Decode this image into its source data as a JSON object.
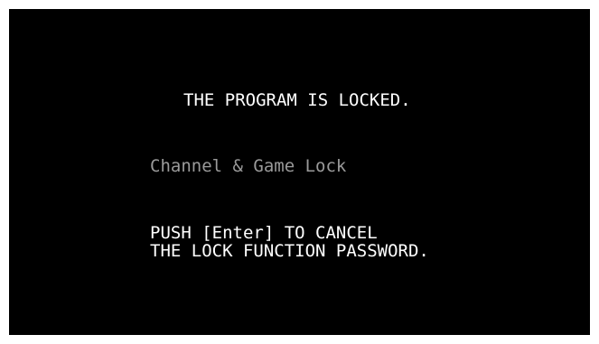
{
  "screen": {
    "title": "THE PROGRAM IS LOCKED.",
    "subtitle": "Channel & Game Lock",
    "instruction_line1": "PUSH [Enter] TO CANCEL",
    "instruction_line2": "THE LOCK FUNCTION PASSWORD."
  },
  "colors": {
    "background": "#000000",
    "text": "#ffffff",
    "subtitle_text": "#9a9a9a",
    "frame": "#ffffff"
  }
}
